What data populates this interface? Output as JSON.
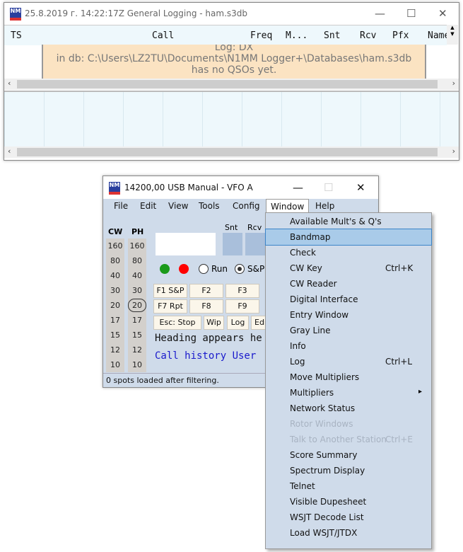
{
  "log_window": {
    "title": "25.8.2019 г. 14:22:17Z  General Logging - ham.s3db",
    "columns": [
      "TS",
      "Call",
      "Freq",
      "M...",
      "Snt",
      "Rcv",
      "Pfx",
      "Name"
    ],
    "message": [
      "Log: DX",
      "in db: C:\\Users\\LZ2TU\\Documents\\N1MM Logger+\\Databases\\ham.s3db",
      "has no QSOs yet."
    ]
  },
  "entry_window": {
    "title": "14200,00 USB Manual - VFO A",
    "menu": [
      "File",
      "Edit",
      "View",
      "Tools",
      "Config",
      "Window",
      "Help"
    ],
    "band_headers": [
      "CW",
      "PH"
    ],
    "bands": [
      "160",
      "80",
      "40",
      "30",
      "20",
      "17",
      "15",
      "12",
      "10"
    ],
    "selected_band": "20",
    "field_labels": {
      "snt": "Snt",
      "rcv": "Rcv"
    },
    "radios": {
      "run": "Run",
      "sp": "S&P",
      "selected": "S&P"
    },
    "buttons_row1": [
      "F1 S&P",
      "F2",
      "F3"
    ],
    "buttons_row2": [
      "F7 Rpt",
      "F8",
      "F9"
    ],
    "buttons_row3": [
      "Esc: Stop",
      "Wip",
      "Log",
      "Edi"
    ],
    "heading_text": "Heading appears he",
    "call_history_text": "Call history User",
    "status": "0 spots loaded after filtering."
  },
  "window_menu": {
    "highlighted": "Bandmap",
    "items": [
      {
        "label": "Available Mult's & Q's"
      },
      {
        "label": "Bandmap"
      },
      {
        "label": "Check"
      },
      {
        "label": "CW Key",
        "shortcut": "Ctrl+K"
      },
      {
        "label": "CW Reader"
      },
      {
        "label": "Digital Interface"
      },
      {
        "label": "Entry Window"
      },
      {
        "label": "Gray Line"
      },
      {
        "label": "Info"
      },
      {
        "label": "Log",
        "shortcut": "Ctrl+L"
      },
      {
        "label": "Move Multipliers"
      },
      {
        "label": "Multipliers",
        "submenu": true
      },
      {
        "label": "Network Status"
      },
      {
        "label": "Rotor Windows",
        "disabled": true
      },
      {
        "label": "Talk to Another Station",
        "shortcut": "Ctrl+E",
        "disabled": true
      },
      {
        "label": "Score Summary"
      },
      {
        "label": "Spectrum Display"
      },
      {
        "label": "Telnet"
      },
      {
        "label": "Visible Dupesheet"
      },
      {
        "label": "WSJT Decode List"
      },
      {
        "label": "Load WSJT/JTDX"
      }
    ]
  },
  "colors": {
    "menu_bg": "#cfdbea",
    "highlight": "#a9cbe9",
    "message_bg": "#fbe3c2",
    "grid_bg": "#eef8fc"
  }
}
